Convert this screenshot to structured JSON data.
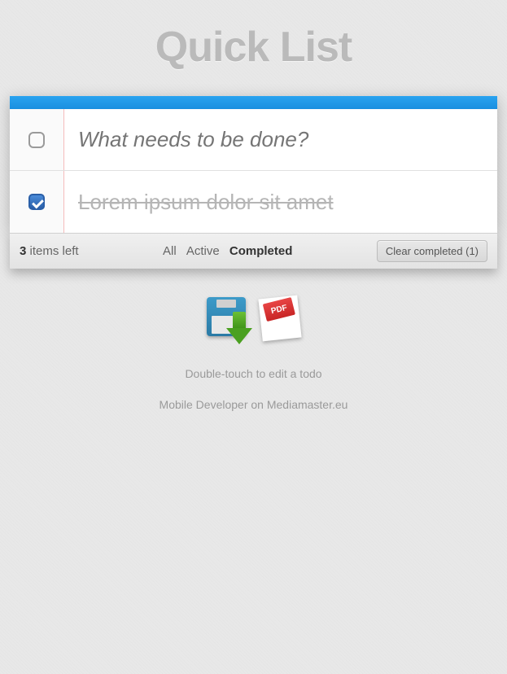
{
  "app": {
    "title": "Quick List"
  },
  "input": {
    "placeholder": "What needs to be done?"
  },
  "todos": [
    {
      "text": "Lorem ipsum dolor sit amet",
      "completed": true
    }
  ],
  "footer": {
    "count": "3",
    "count_suffix": "items left",
    "filters": {
      "all": "All",
      "active": "Active",
      "completed": "Completed"
    },
    "active_filter": "completed",
    "clear_label": "Clear completed (1)"
  },
  "icons": {
    "save": "save-download-icon",
    "pdf_label": "PDF"
  },
  "tips": {
    "edit": "Double-touch to edit a todo",
    "credit": "Mobile Developer on Mediamaster.eu"
  }
}
